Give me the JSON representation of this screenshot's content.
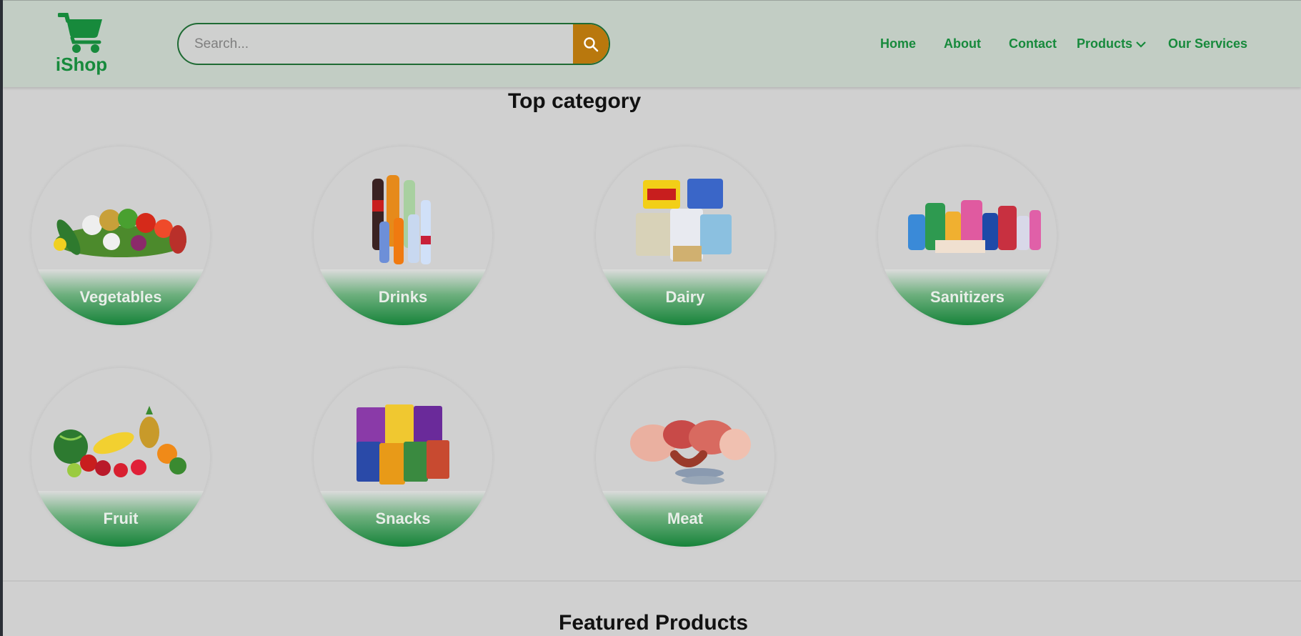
{
  "brand": {
    "name": "iShop",
    "color": "#178a3c",
    "accent": "#b9780d"
  },
  "search": {
    "placeholder": "Search...",
    "value": ""
  },
  "nav": {
    "home": "Home",
    "about": "About",
    "contact": "Contact",
    "products": "Products",
    "services": "Our Services"
  },
  "top_category": {
    "title": "Top category",
    "items": [
      {
        "label": "Vegetables",
        "icon": "vegetables-image"
      },
      {
        "label": "Drinks",
        "icon": "drinks-image"
      },
      {
        "label": "Dairy",
        "icon": "dairy-image"
      },
      {
        "label": "Sanitizers",
        "icon": "sanitizers-image"
      },
      {
        "label": "Fruit",
        "icon": "fruit-image"
      },
      {
        "label": "Snacks",
        "icon": "snacks-image"
      },
      {
        "label": "Meat",
        "icon": "meat-image"
      }
    ]
  },
  "featured": {
    "title": "Featured Products"
  }
}
